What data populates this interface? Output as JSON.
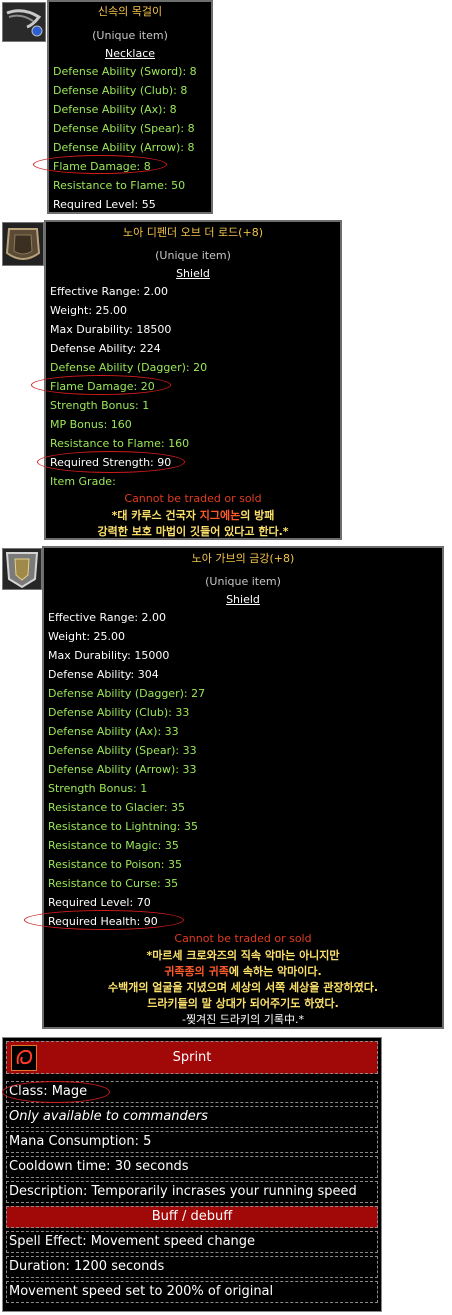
{
  "item1": {
    "title": "신속의 목걸이",
    "subtitle": "(Unique item)",
    "type": "Necklace",
    "stats": [
      {
        "text": "Defense Ability (Sword): 8",
        "color": "green"
      },
      {
        "text": "Defense Ability (Club): 8",
        "color": "green"
      },
      {
        "text": "Defense Ability (Ax): 8",
        "color": "green"
      },
      {
        "text": "Defense Ability (Spear): 8",
        "color": "green"
      },
      {
        "text": "Defense Ability (Arrow): 8",
        "color": "green"
      },
      {
        "text": "Flame Damage: 8",
        "color": "green"
      },
      {
        "text": "Resistance to Flame: 50",
        "color": "green"
      },
      {
        "text": "Required Level: 55",
        "color": "white"
      }
    ]
  },
  "item2": {
    "title": "노아 디펜더 오브 더 로드(+8)",
    "subtitle": "(Unique item)",
    "type": "Shield",
    "stats": [
      {
        "text": "Effective Range: 2.00",
        "color": "white"
      },
      {
        "text": "Weight: 25.00",
        "color": "white"
      },
      {
        "text": "Max Durability: 18500",
        "color": "white"
      },
      {
        "text": "Defense Ability: 224",
        "color": "white"
      },
      {
        "text": "Defense Ability (Dagger): 20",
        "color": "green"
      },
      {
        "text": "Flame Damage: 20",
        "color": "green"
      },
      {
        "text": "Strength Bonus: 1",
        "color": "green"
      },
      {
        "text": "MP Bonus: 160",
        "color": "green"
      },
      {
        "text": "Resistance to Flame: 160",
        "color": "green"
      },
      {
        "text": "Required Strength: 90",
        "color": "white"
      },
      {
        "text": "Item Grade:",
        "color": "green"
      }
    ],
    "trade_note": "Cannot be traded or sold",
    "lore_1a": "*대 카루스 건국자 ",
    "lore_1b": "지그에논",
    "lore_1c": "의 방패",
    "lore_2": "강력한 보호 마법이 깃들어 있다고 한다.*"
  },
  "item3": {
    "title": "노아 가브의 금강(+8)",
    "subtitle": "(Unique item)",
    "type": "Shield",
    "stats": [
      {
        "text": "Effective Range: 2.00",
        "color": "white"
      },
      {
        "text": "Weight: 25.00",
        "color": "white"
      },
      {
        "text": "Max Durability: 15000",
        "color": "white"
      },
      {
        "text": "Defense Ability: 304",
        "color": "white"
      },
      {
        "text": "Defense Ability (Dagger): 27",
        "color": "green"
      },
      {
        "text": "Defense Ability (Club): 33",
        "color": "green"
      },
      {
        "text": "Defense Ability (Ax): 33",
        "color": "green"
      },
      {
        "text": "Defense Ability (Spear): 33",
        "color": "green"
      },
      {
        "text": "Defense Ability (Arrow): 33",
        "color": "green"
      },
      {
        "text": "Strength Bonus: 1",
        "color": "green"
      },
      {
        "text": "Resistance to Glacier: 35",
        "color": "green"
      },
      {
        "text": "Resistance to Lightning: 35",
        "color": "green"
      },
      {
        "text": "Resistance to Magic: 35",
        "color": "green"
      },
      {
        "text": "Resistance to Poison: 35",
        "color": "green"
      },
      {
        "text": "Resistance to Curse: 35",
        "color": "green"
      },
      {
        "text": "Required Level: 70",
        "color": "white"
      },
      {
        "text": "Required Health: 90",
        "color": "white"
      }
    ],
    "trade_note": "Cannot be traded or sold",
    "lore_1a": "*마르세 크로와즈의 직속 악마는 아니지만",
    "lore_2a": "귀족종의 ",
    "lore_2b": "귀족",
    "lore_2c": "에 속하는 악마이다.",
    "lore_3": "수백개의 얼굴을 지녔으며 세상의 서쪽 세상을 관장하였다.",
    "lore_4": "드라키들의 말 상대가 되어주기도 하였다.",
    "lore_5": "-찢겨진 드라키의 기록中.*"
  },
  "skill": {
    "name": "Sprint",
    "class": "Class: Mage",
    "restriction": "Only available to commanders",
    "mana": "Mana Consumption: 5",
    "cooldown": "Cooldown time: 30 seconds",
    "description": "Description: Temporarily incrases your running speed",
    "category": "Buff / debuff",
    "effect": "Spell Effect: Movement speed change",
    "duration": "Duration: 1200 seconds",
    "result": "Movement speed set to 200% of original"
  },
  "colors": {
    "green": "#9be85a",
    "white": "#ffffff",
    "title": "#f3c24a",
    "red_note": "#e03b22",
    "skill_bar": "#a10808"
  }
}
